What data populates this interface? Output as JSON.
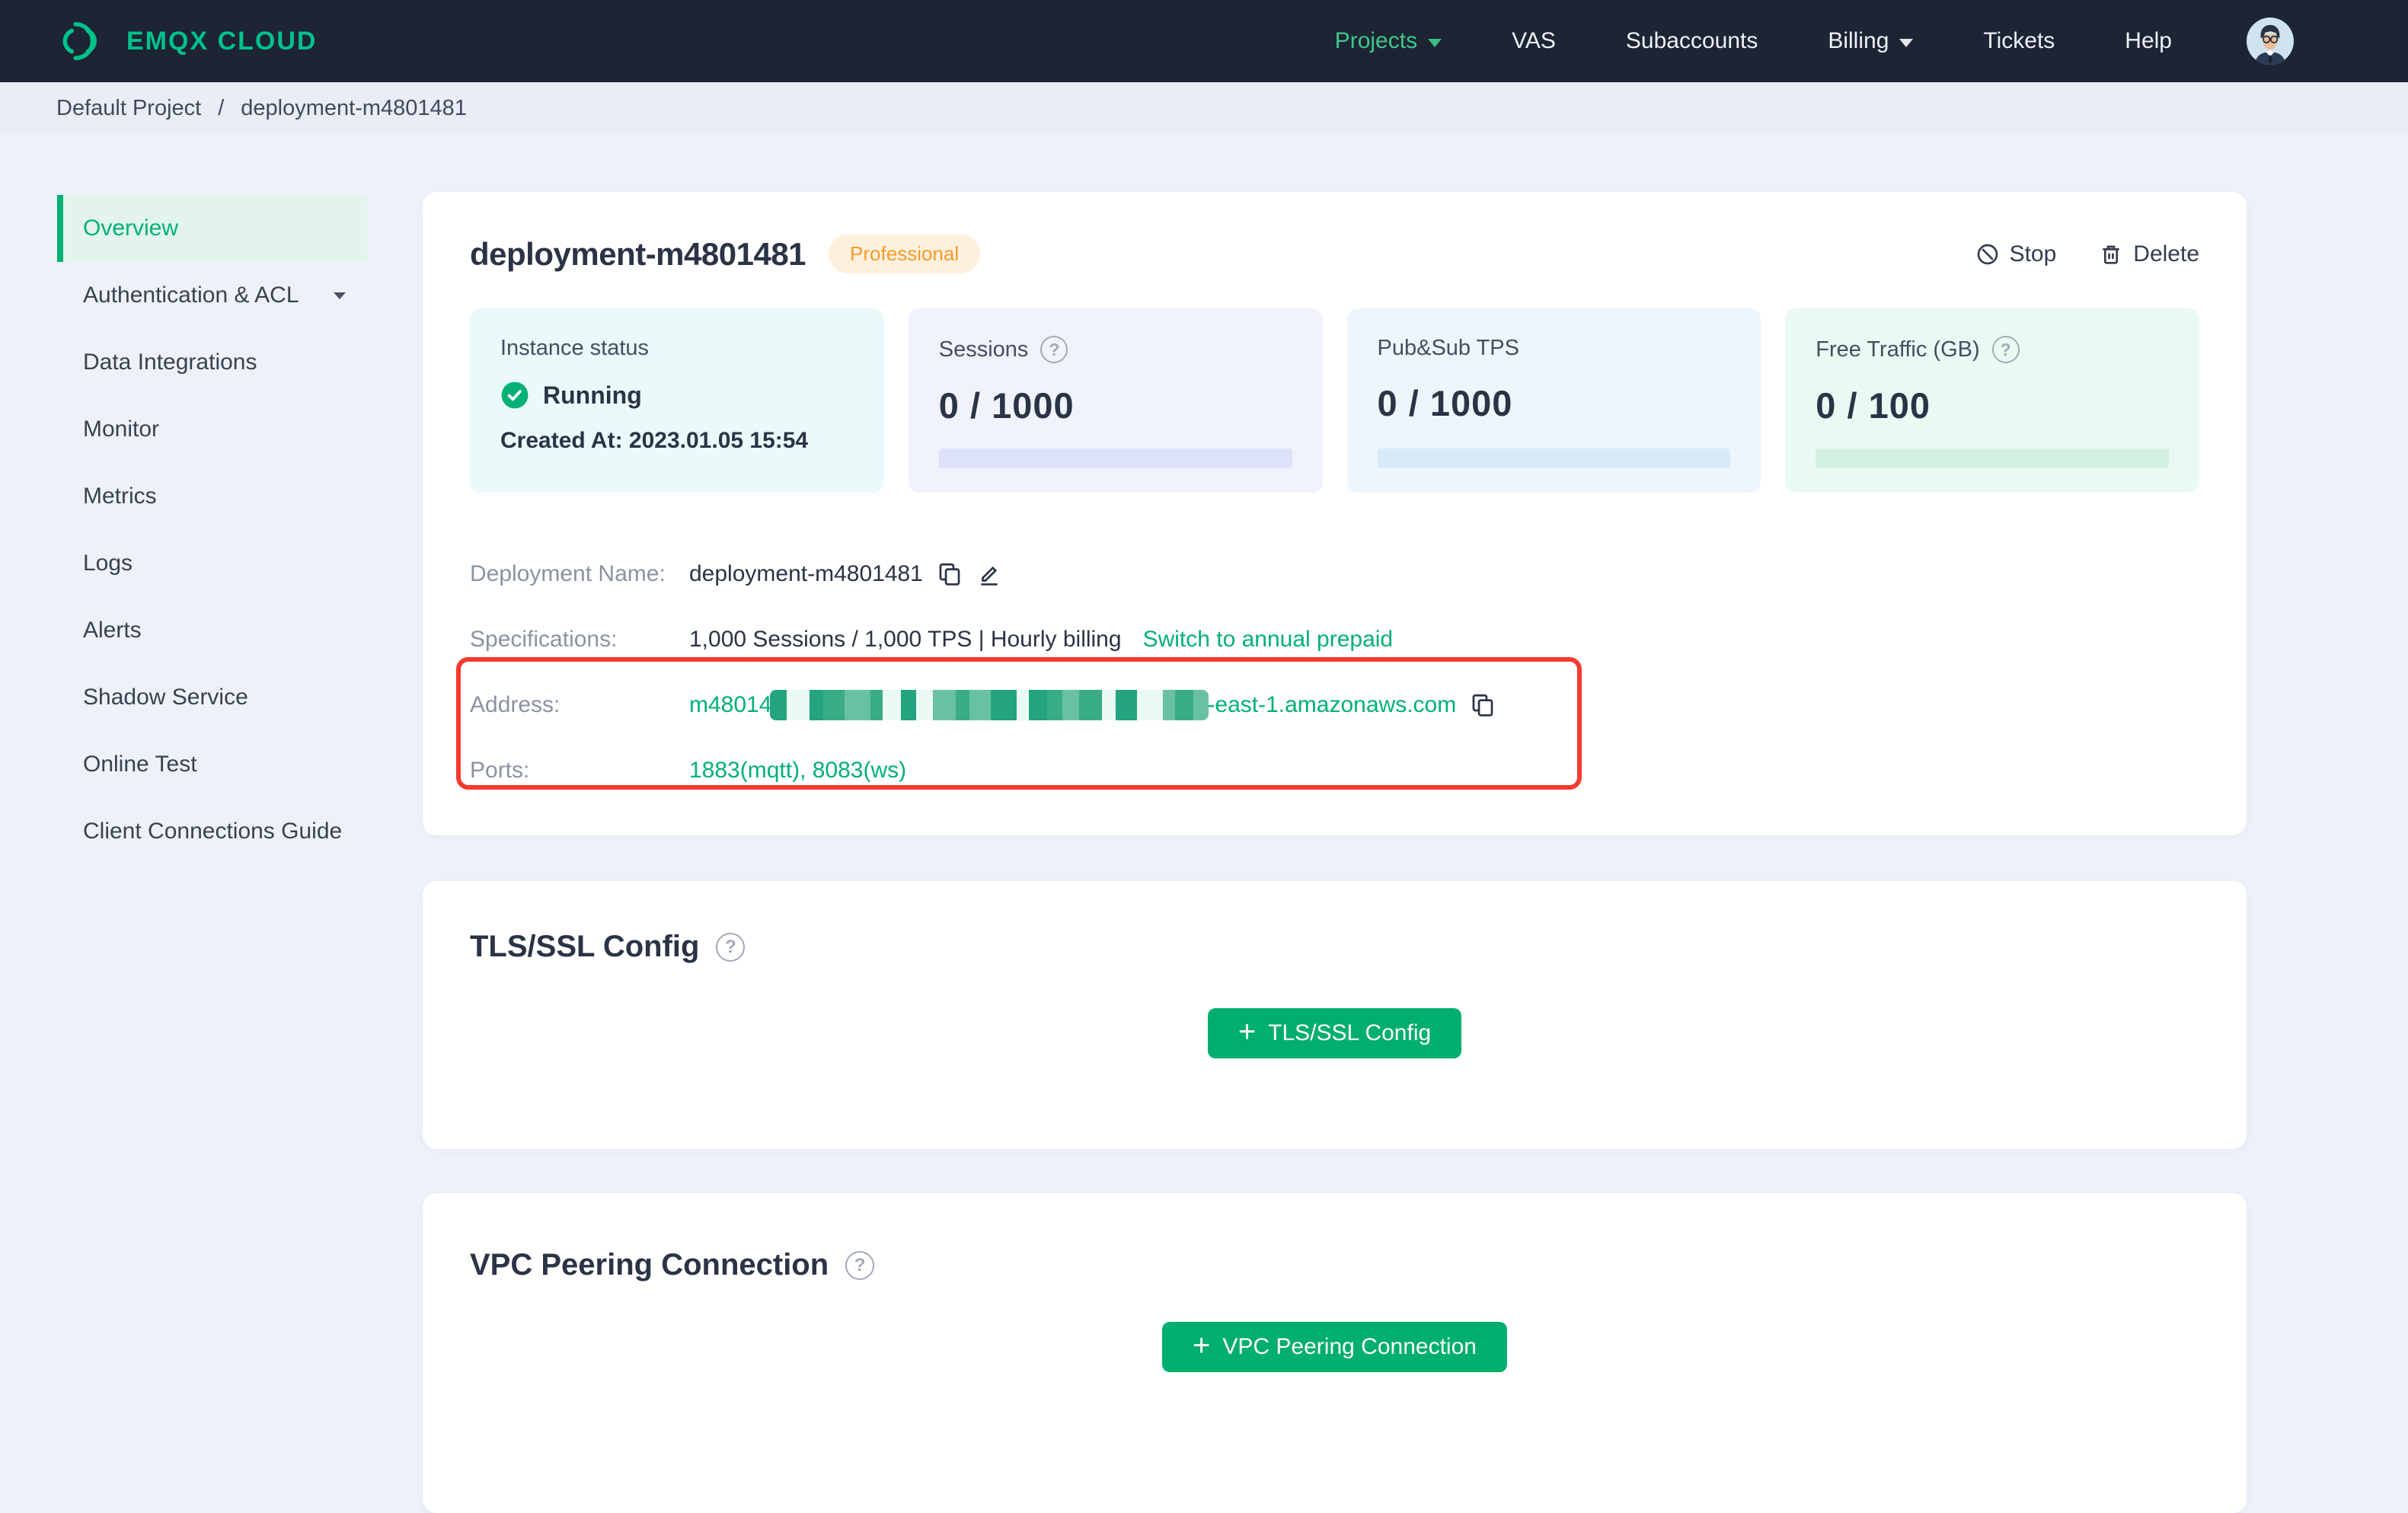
{
  "colors": {
    "accent": "#00b173",
    "brand_green": "#00c18a",
    "navbar_bg": "#1d2433",
    "page_bg": "#edf1f9",
    "breadcrumb_bg": "#e9edf6",
    "sidebar_active_bg": "#e2f4ec",
    "text_dark": "#2b3346",
    "text_gray": "#8b93a1",
    "badge_bg": "#fdf1de",
    "badge_text": "#f79a2b",
    "annotation_red": "#f5392d",
    "stat1_bg": "#eafafa",
    "stat2_bg": "#f0f2fc",
    "stat3_bg": "#eef5fd",
    "stat4_bg": "#e9faf3",
    "prog2": "#dee2f8",
    "prog3": "#d7eafa",
    "prog4": "#d2f0e2"
  },
  "navbar": {
    "brand": "EMQX CLOUD",
    "items": [
      "Projects",
      "VAS",
      "Subaccounts",
      "Billing",
      "Tickets",
      "Help"
    ]
  },
  "breadcrumb": {
    "separator": "/",
    "items": [
      "Default Project",
      "deployment-m4801481"
    ]
  },
  "sidebar": {
    "items": [
      "Overview",
      "Authentication & ACL",
      "Data Integrations",
      "Monitor",
      "Metrics",
      "Logs",
      "Alerts",
      "Shadow Service",
      "Online Test",
      "Client Connections Guide"
    ]
  },
  "deployment": {
    "title": "deployment-m4801481",
    "plan_badge": "Professional",
    "actions": {
      "stop": "Stop",
      "delete": "Delete"
    },
    "stats": [
      {
        "label": "Instance status",
        "status": "Running",
        "created_at": "Created At: 2023.01.05 15:54"
      },
      {
        "label": "Sessions",
        "value": "0 / 1000"
      },
      {
        "label": "Pub&Sub TPS",
        "value": "0 / 1000"
      },
      {
        "label": "Free Traffic (GB)",
        "value": "0 / 100"
      }
    ],
    "info": {
      "deployment_name": {
        "label": "Deployment Name:",
        "value": "deployment-m4801481"
      },
      "specifications": {
        "label": "Specifications:",
        "value": "1,000 Sessions / 1,000 TPS | Hourly billing",
        "link": "Switch to annual prepaid"
      },
      "address": {
        "label": "Address:",
        "prefix": "m48014",
        "suffix": "-east-1.amazonaws.com",
        "redaction_colors": [
          "#23a47e",
          "#5cb89a",
          "#8fcfb6",
          "#3aab87",
          "#d2f2e5",
          "#b0e4d2",
          "#eafaf4",
          "#7cc7ad",
          "#46b28e",
          "#69c1a4",
          "#c7eedd",
          "#34a07c"
        ]
      },
      "ports": {
        "label": "Ports:",
        "value": "1883(mqtt), 8083(ws)"
      }
    }
  },
  "sections": {
    "tls": {
      "title": "TLS/SSL Config",
      "button": "TLS/SSL Config"
    },
    "vpc": {
      "title": "VPC Peering Connection",
      "button": "VPC Peering Connection"
    }
  }
}
